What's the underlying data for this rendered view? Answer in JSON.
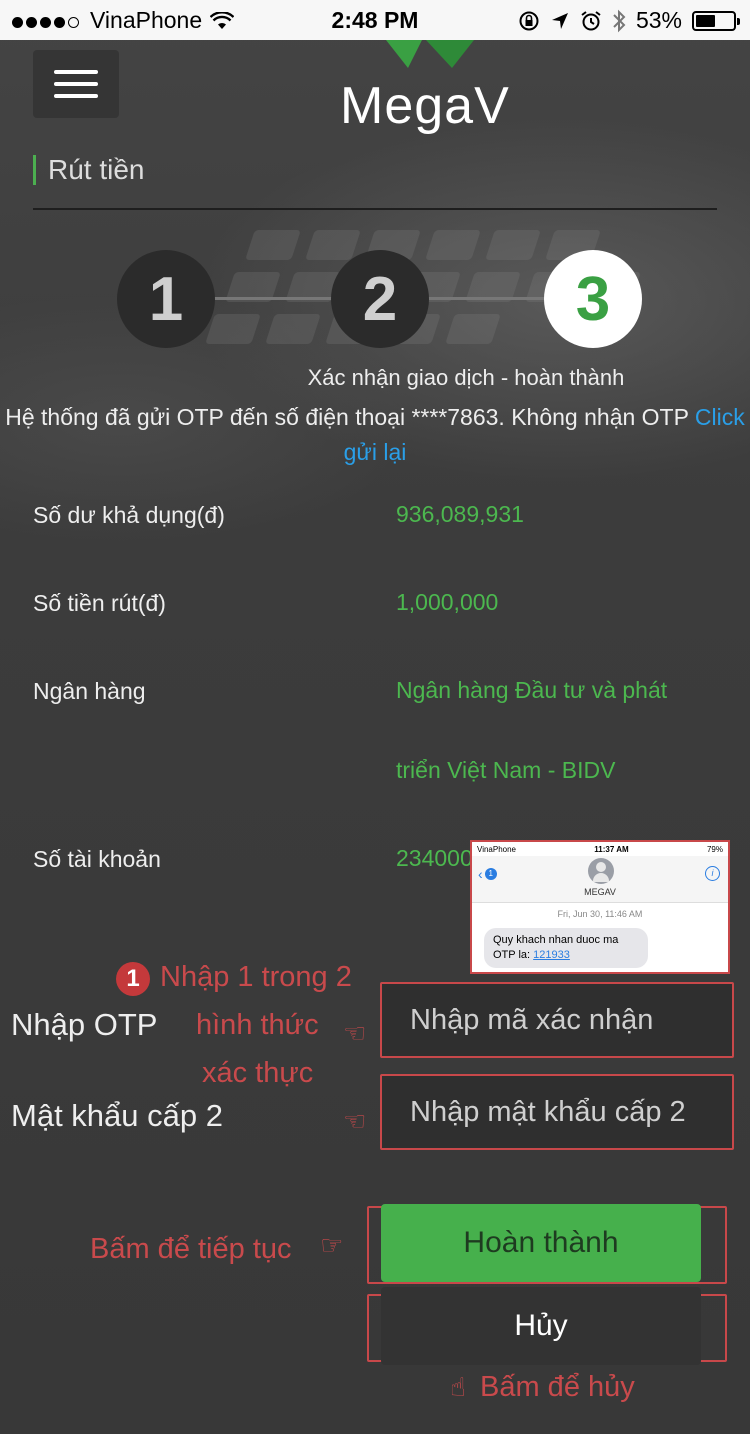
{
  "status_bar": {
    "carrier": "VinaPhone",
    "time": "2:48 PM",
    "battery": "53%",
    "battery_level": 0.53
  },
  "header": {
    "logo_text": "MegaV",
    "menu_icon": "hamburger-icon"
  },
  "page": {
    "title": "Rút tiền"
  },
  "steps": {
    "items": [
      "1",
      "2",
      "3"
    ],
    "active_index": 2,
    "caption": "Xác nhận giao dịch - hoàn thành"
  },
  "otp_notice": {
    "text": "Hệ thống đã gửi OTP đến số điện thoại ****7863. Không nhận OTP",
    "resend_link": "Click gửi lại"
  },
  "details": {
    "balance": {
      "label": "Số dư khả dụng(đ)",
      "value": "936,089,931"
    },
    "amount": {
      "label": "Số tiền rút(đ)",
      "value": "1,000,000"
    },
    "bank": {
      "label": "Ngân hàng",
      "value": "Ngân hàng Đầu tư và phát triển Việt Nam - BIDV"
    },
    "account": {
      "label": "Số tài khoản",
      "value": "234000"
    }
  },
  "form": {
    "otp_label": "Nhập OTP",
    "otp_placeholder": "Nhập mã xác nhận",
    "pin_label": "Mật khẩu cấp 2",
    "pin_placeholder": "Nhập mật khẩu cấp 2"
  },
  "buttons": {
    "submit": "Hoàn thành",
    "cancel": "Hủy"
  },
  "annotations": {
    "badge": "1",
    "auth_line1": "Nhập 1 trong 2",
    "auth_line2": "hình thức",
    "auth_line3": "xác thực",
    "continue": "Bấm để tiếp tục",
    "cancel": "Bấm để hủy"
  },
  "sms_preview": {
    "carrier": "VinaPhone",
    "time": "11:37 AM",
    "battery": "79%",
    "unread_count": "1",
    "sender": "MEGAV",
    "date": "Fri, Jun 30, 11:46 AM",
    "message": "Quy khach nhan duoc ma OTP la:",
    "code": "121933"
  },
  "colors": {
    "accent_green": "#4cb84f",
    "link_blue": "#2a9fe8",
    "annotation_red": "#c94a4c"
  }
}
